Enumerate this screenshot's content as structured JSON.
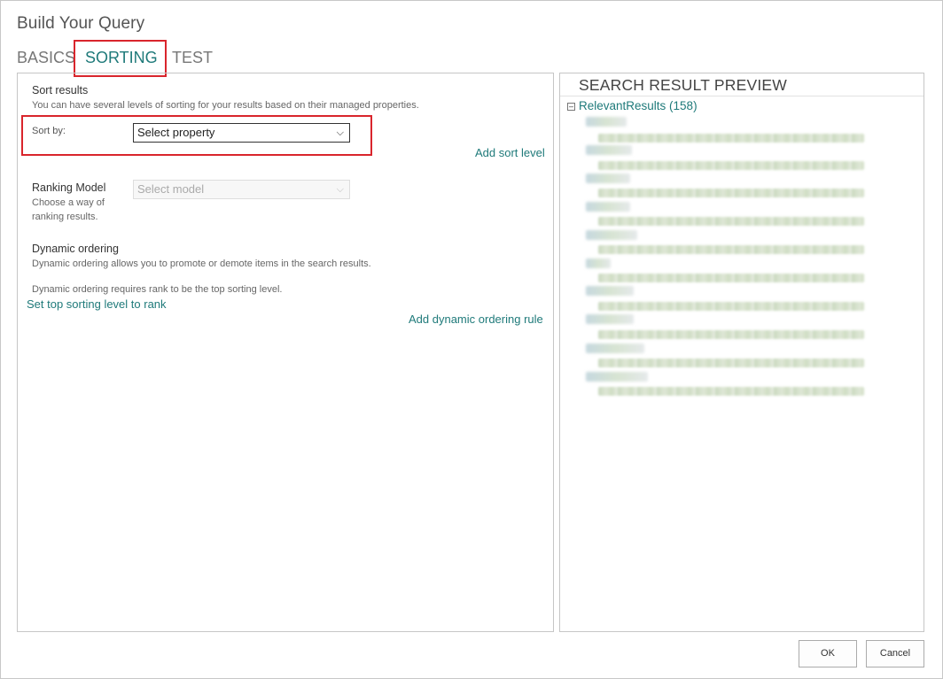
{
  "dialog": {
    "title": "Build Your Query"
  },
  "tabs": [
    {
      "label": "BASICS"
    },
    {
      "label": "SORTING",
      "selected": true
    },
    {
      "label": "TEST"
    }
  ],
  "sort_results": {
    "title": "Sort results",
    "description": "You can have several levels of sorting for your results based on their managed properties.",
    "sort_by_label": "Sort by:",
    "sort_by_value": "Select property",
    "add_sort_level": "Add sort level"
  },
  "ranking_model": {
    "title": "Ranking Model",
    "description_line1": "Choose a way of",
    "description_line2": "ranking results.",
    "select_value": "Select model",
    "enabled": false
  },
  "dynamic_ordering": {
    "title": "Dynamic ordering",
    "description": "Dynamic ordering allows you to promote or demote items in the search results.",
    "requirement": "Dynamic ordering requires rank to be the top sorting level.",
    "set_top_link": "Set top sorting level to rank",
    "add_rule_link": "Add dynamic ordering rule"
  },
  "preview": {
    "title": "SEARCH RESULT PREVIEW",
    "root_label": "RelevantResults (158)",
    "toggle_icon": "collapse-minus"
  },
  "buttons": {
    "ok": "OK",
    "cancel": "Cancel"
  },
  "colors": {
    "accent": "#1f7a7a",
    "highlight": "#d9252c"
  }
}
